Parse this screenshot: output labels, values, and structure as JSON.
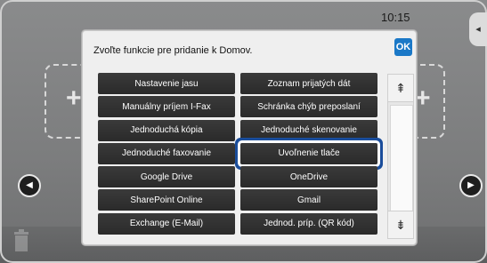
{
  "status": {
    "time": "10:15"
  },
  "dialog": {
    "title": "Zvoľte funkcie pre pridanie k Domov.",
    "ok_label": "OK"
  },
  "functions": [
    [
      "Nastavenie jasu",
      "Zoznam prijatých dát"
    ],
    [
      "Manuálny príjem I-Fax",
      "Schránka chýb preposlaní"
    ],
    [
      "Jednoduchá kópia",
      "Jednoduché skenovanie"
    ],
    [
      "Jednoduché faxovanie",
      "Uvoľnenie tlače"
    ],
    [
      "Google Drive",
      "OneDrive"
    ],
    [
      "SharePoint Online",
      "Gmail"
    ],
    [
      "Exchange (E-Mail)",
      "Jednod. príp. (QR kód)"
    ]
  ],
  "selected": "Uvoľnenie tlače",
  "icons": {
    "scroll_up": "double-chevron-up-icon",
    "scroll_down": "double-chevron-down-icon",
    "nav_left": "arrow-left-icon",
    "nav_right": "arrow-right-icon",
    "trash": "trash-icon"
  },
  "colors": {
    "ok": "#1a78c7",
    "highlight": "#1a4d9b"
  }
}
